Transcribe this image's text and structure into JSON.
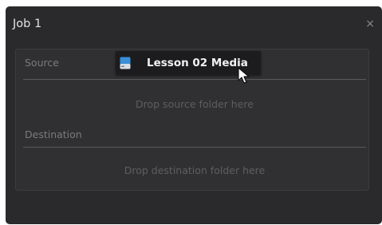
{
  "job": {
    "title": "Job 1",
    "close_glyph": "×"
  },
  "source": {
    "label": "Source",
    "drop_placeholder": "Drop source folder here"
  },
  "destination": {
    "label": "Destination",
    "drop_placeholder": "Drop destination folder here"
  },
  "drag_item": {
    "label": "Lesson 02 Media",
    "icon": "drive-icon"
  },
  "colors": {
    "panel_bg": "#2a2a2c",
    "card_bg": "#303032",
    "drive_icon_blue": "#3a8fd9"
  }
}
